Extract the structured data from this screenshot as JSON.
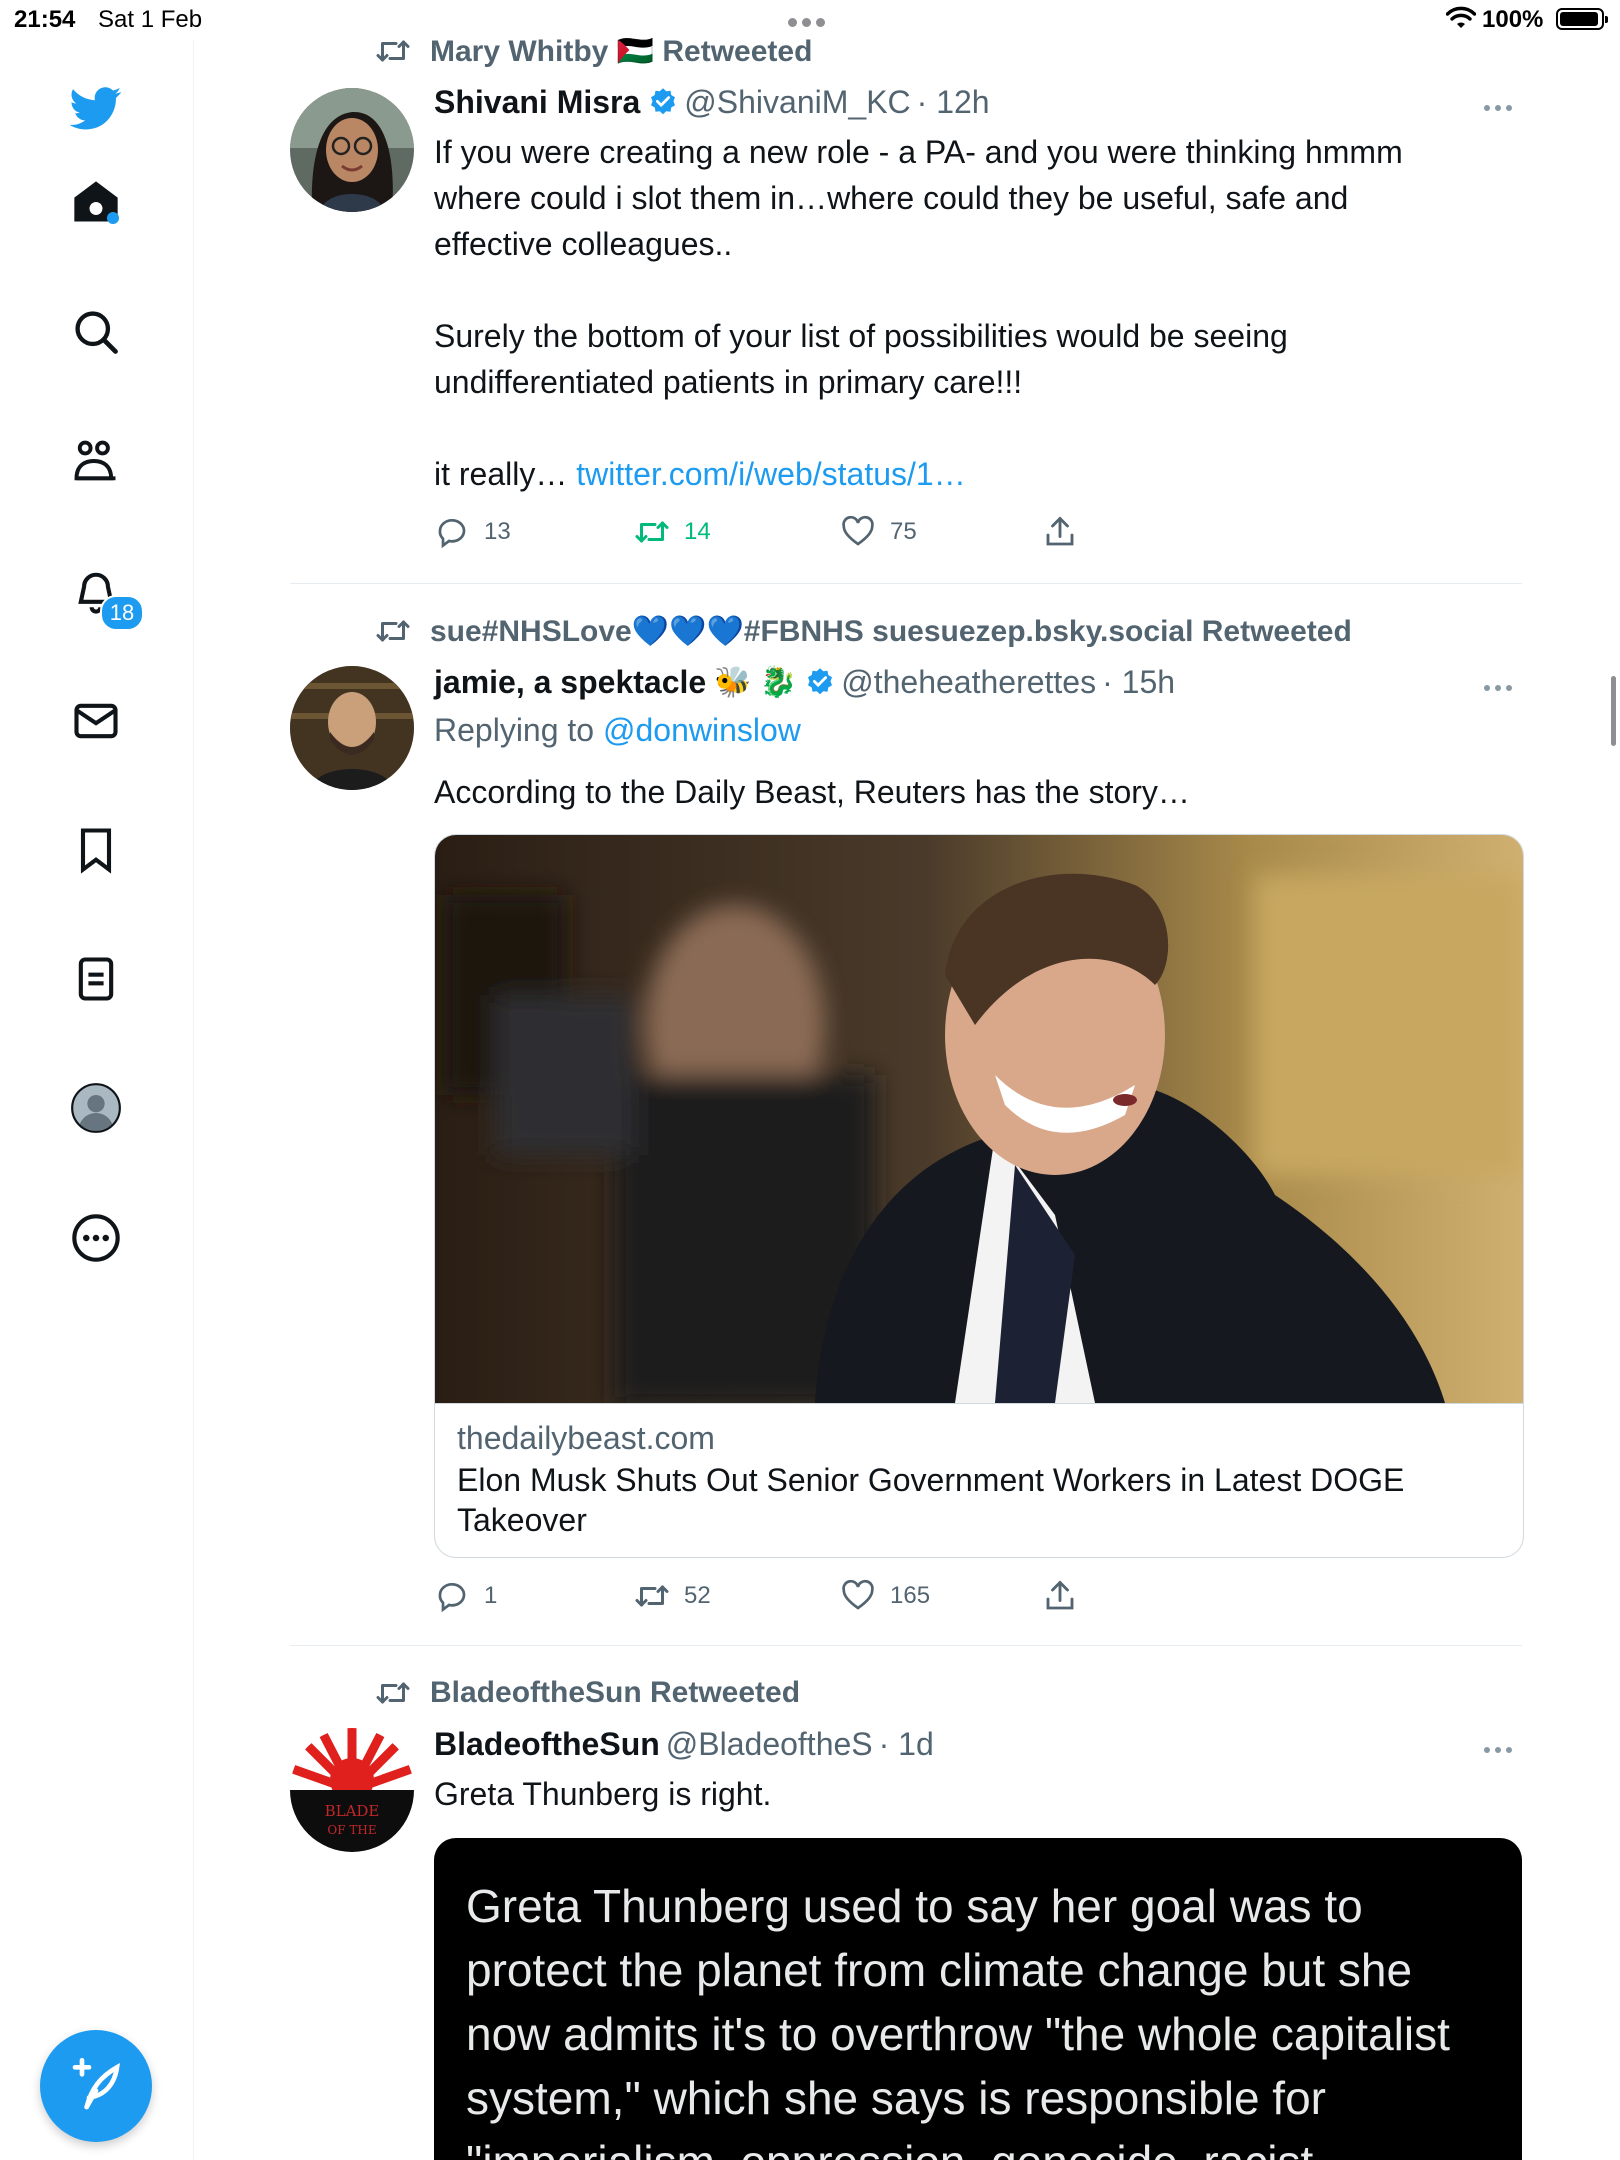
{
  "status_bar": {
    "time": "21:54",
    "date": "Sat 1 Feb",
    "battery": "100%"
  },
  "sidebar": {
    "items": [
      {
        "name": "twitter-logo"
      },
      {
        "name": "home"
      },
      {
        "name": "explore"
      },
      {
        "name": "communities"
      },
      {
        "name": "notifications",
        "badge": "18"
      },
      {
        "name": "messages"
      },
      {
        "name": "bookmarks"
      },
      {
        "name": "lists"
      },
      {
        "name": "profile"
      },
      {
        "name": "more"
      }
    ],
    "accent": "#1d9bf0"
  },
  "tweets": [
    {
      "retweeted_by": "Mary Whitby 🇵🇸 Retweeted",
      "name": "Shivani Misra",
      "verified": true,
      "handle": "@ShivaniM_KC",
      "time": "· 12h",
      "text_lines": [
        "If you were creating a new role - a PA- and you were thinking hmmm",
        "where could i slot them in…where could they be useful, safe and",
        "effective colleagues..",
        "",
        "Surely the bottom of your list of possibilities would be seeing",
        "undifferentiated patients in primary care!!!",
        "",
        "it really… "
      ],
      "link": "twitter.com/i/web/status/1…",
      "replies": "13",
      "retweets": "14",
      "likes": "75",
      "retweeted_by_me": true
    },
    {
      "retweeted_by": "sue#NHSLove💙💙💙#FBNHS suesuezep.bsky.social Retweeted",
      "name": "jamie, a spektacle",
      "name_emoji": "🐝 🐉",
      "verified": true,
      "handle": "@theheatherettes",
      "time": "· 15h",
      "replying_prefix": "Replying to ",
      "replying_to": "@donwinslow",
      "text": "According to the Daily Beast, Reuters has the story…",
      "card": {
        "domain": "thedailybeast.com",
        "title": "Elon Musk Shuts Out Senior Government Workers in Latest DOGE Takeover"
      },
      "replies": "1",
      "retweets": "52",
      "likes": "165"
    },
    {
      "retweeted_by": "BladeoftheSun Retweeted",
      "name": "BladeoftheSun",
      "verified": false,
      "handle": "@BladeoftheS",
      "time": "· 1d",
      "text": "Greta Thunberg is right.",
      "avatar_text": "BLADE OF THE",
      "quote_text": "Greta Thunberg used to say her goal was to protect the planet from climate change but she now admits it's to overthrow \"the whole capitalist system,\" which she says is responsible for \"imperialism, oppression, genocide, racist"
    }
  ]
}
